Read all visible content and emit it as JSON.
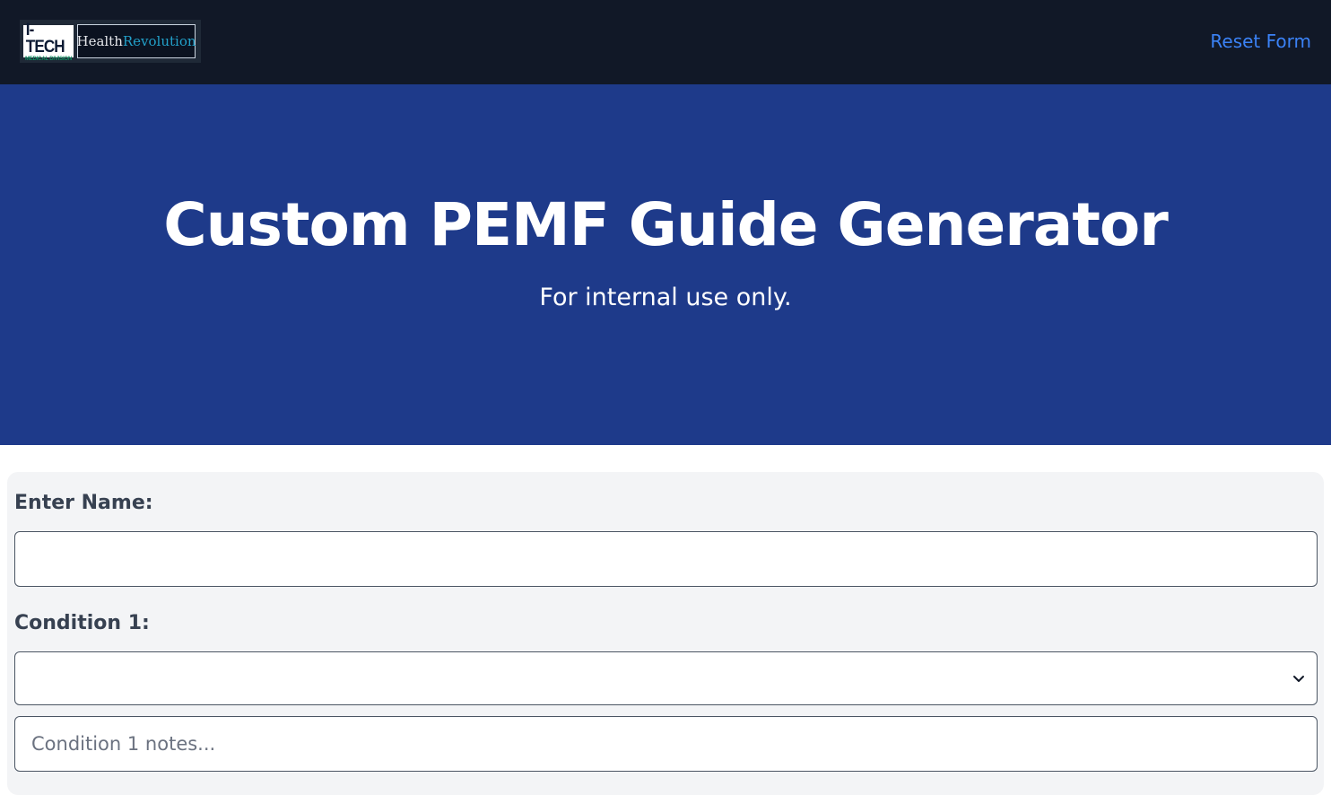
{
  "navbar": {
    "logo": {
      "itech_main": "I-TECH",
      "itech_sub": "MEDICAL DIVISION",
      "health_part1": "Health",
      "health_part2": "Revolution"
    },
    "reset_label": "Reset Form",
    "bg_color": "#111827",
    "link_color": "#3b82f6"
  },
  "hero": {
    "title": "Custom PEMF Guide Generator",
    "subtitle": "For internal use only.",
    "bg_color": "#1e3a8a"
  },
  "form": {
    "name_label": "Enter Name:",
    "name_value": "",
    "condition1_label": "Condition 1:",
    "condition1_selected": "",
    "condition1_notes_placeholder": "Condition 1 notes...",
    "condition1_notes_value": "",
    "card_bg": "#f3f4f6"
  }
}
